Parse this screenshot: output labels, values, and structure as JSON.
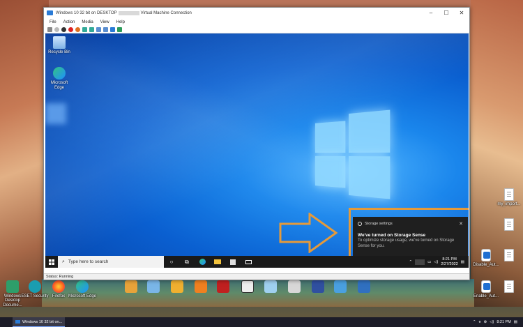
{
  "vm_window": {
    "title_prefix": "Windows 10 32 bit on DESKTOP",
    "title_suffix": "Virtual Machine Connection",
    "controls": {
      "minimize": "–",
      "maximize": "☐",
      "close": "✕"
    },
    "menu": [
      "File",
      "Action",
      "Media",
      "View",
      "Help"
    ],
    "status": "Status: Running"
  },
  "guest_desktop": {
    "icons": [
      {
        "label": "Recycle Bin"
      },
      {
        "label": "Microsoft Edge"
      }
    ],
    "notification": {
      "app": "Storage settings",
      "close": "✕",
      "title": "We've turned on Storage Sense",
      "body": "To optimize storage usage, we've turned on Storage Sense for you."
    },
    "taskbar": {
      "search_placeholder": "Type here to search",
      "time": "8:21 PM",
      "date": "2/27/2022"
    }
  },
  "host_desktop": {
    "right_icons": [
      {
        "label": "my_import..."
      },
      {
        "label": ""
      },
      {
        "label": "Disable_Aut..."
      },
      {
        "label": "Enable_Aut..."
      }
    ],
    "bottom_icons": [
      {
        "label": "Windows Desktop Docume..."
      },
      {
        "label": "ESET Security"
      },
      {
        "label": "Firefox"
      },
      {
        "label": "Microsoft Edge"
      }
    ],
    "taskbar": {
      "app_label": "Windows 10 32 bit on...",
      "time": "8:21 PM"
    }
  },
  "colors": {
    "highlight": "#e59a3a",
    "guest_bg": "#0a5fd0",
    "taskbar": "#1a1a1a"
  }
}
